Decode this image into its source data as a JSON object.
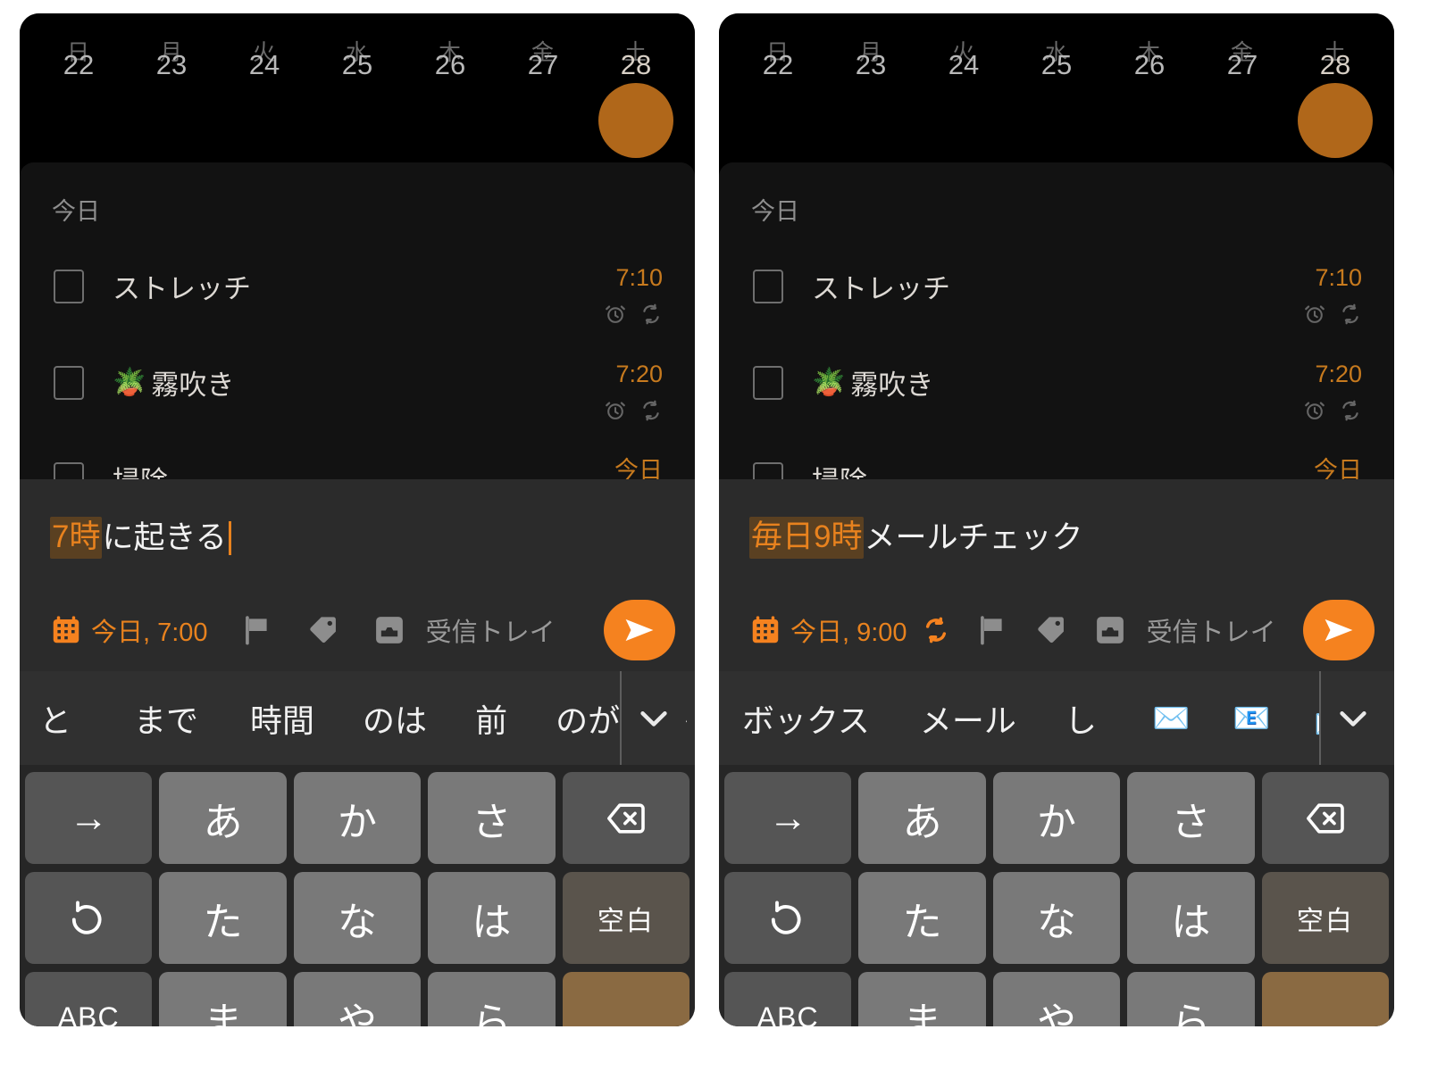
{
  "panels": [
    {
      "id": "left",
      "week": {
        "dow": [
          "日",
          "月",
          "火",
          "水",
          "木",
          "金",
          "土"
        ],
        "dates": [
          "22",
          "23",
          "24",
          "25",
          "26",
          "27",
          "28"
        ],
        "today_index": 6,
        "today_color": "#b0671a"
      },
      "section_label": "今日",
      "tasks": [
        {
          "emoji": "",
          "title": "ストレッチ",
          "time": "7:10",
          "has_alarm": true,
          "has_repeat": true
        },
        {
          "emoji": "🪴",
          "title": "霧吹き",
          "time": "7:20",
          "has_alarm": true,
          "has_repeat": true
        },
        {
          "emoji": "",
          "title": "掃除",
          "time": "今日",
          "has_alarm": false,
          "has_repeat": false
        }
      ],
      "quickadd": {
        "highlight": "7時",
        "rest": "に起きる",
        "date_label": "今日, 7:00",
        "show_repeat_chip": false,
        "inbox_label": "受信トレイ",
        "accent": "#e8821e",
        "send_icon": "send-icon"
      },
      "suggestions": [
        "と",
        "まで",
        "時間",
        "のは",
        "前",
        "のが",
        "か"
      ],
      "keyboard": {
        "rows": [
          [
            "→",
            "あ",
            "か",
            "さ",
            "⌫"
          ],
          [
            "↺",
            "た",
            "な",
            "は",
            "空白"
          ],
          [
            "ABC",
            "ま",
            "や",
            "ら",
            ""
          ]
        ]
      }
    },
    {
      "id": "right",
      "week": {
        "dow": [
          "日",
          "月",
          "火",
          "水",
          "木",
          "金",
          "土"
        ],
        "dates": [
          "22",
          "23",
          "24",
          "25",
          "26",
          "27",
          "28"
        ],
        "today_index": 6,
        "today_color": "#b0671a"
      },
      "section_label": "今日",
      "tasks": [
        {
          "emoji": "",
          "title": "ストレッチ",
          "time": "7:10",
          "has_alarm": true,
          "has_repeat": true
        },
        {
          "emoji": "🪴",
          "title": "霧吹き",
          "time": "7:20",
          "has_alarm": true,
          "has_repeat": true
        },
        {
          "emoji": "",
          "title": "掃除",
          "time": "今日",
          "has_alarm": false,
          "has_repeat": false
        }
      ],
      "quickadd": {
        "highlight": "毎日9時",
        "rest": "メールチェック",
        "date_label": "今日, 9:00",
        "show_repeat_chip": true,
        "inbox_label": "受信トレイ",
        "accent": "#e8821e",
        "send_icon": "send-icon"
      },
      "suggestions": [
        "ボックス",
        "メール",
        "し",
        "✉️",
        "📧",
        "📩"
      ],
      "keyboard": {
        "rows": [
          [
            "→",
            "あ",
            "か",
            "さ",
            "⌫"
          ],
          [
            "↺",
            "た",
            "な",
            "は",
            "空白"
          ],
          [
            "ABC",
            "ま",
            "や",
            "ら",
            ""
          ]
        ]
      }
    }
  ]
}
